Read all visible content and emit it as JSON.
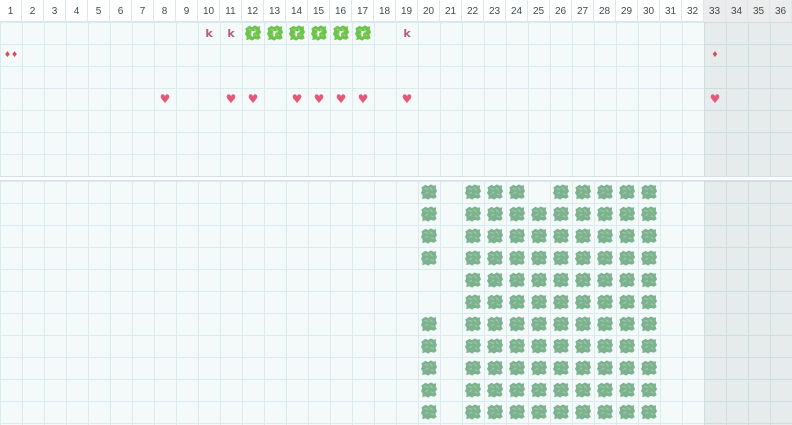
{
  "calendar": {
    "days": [
      "1",
      "2",
      "3",
      "4",
      "5",
      "6",
      "7",
      "8",
      "9",
      "10",
      "11",
      "12",
      "13",
      "14",
      "15",
      "16",
      "17",
      "18",
      "19",
      "20",
      "21",
      "22",
      "23",
      "24",
      "25",
      "26",
      "27",
      "28",
      "29",
      "30",
      "31",
      "32",
      "33",
      "34",
      "35",
      "36"
    ],
    "off_from_day": 33,
    "colors": {
      "grid": "#d9ebee",
      "background": "#f4f9fa",
      "moss": "#7cb38e",
      "sprout": "#6cc44a",
      "heart": "#e4587a",
      "drop": "#dc4a5a",
      "letter": "#b0607a"
    }
  },
  "markers": {
    "k_days": [
      10,
      11,
      19
    ],
    "k_letter": "k",
    "sprout_days": [
      12,
      13,
      14,
      15,
      16,
      17
    ],
    "sprout_letter": "r",
    "drop_days": [
      1,
      33
    ],
    "heart_days": [
      8,
      11,
      12,
      14,
      15,
      16,
      17,
      19,
      33
    ],
    "icons": {
      "k": "k-letter-icon",
      "sprout": "sprout-icon",
      "drop": "drop-icon",
      "heart": "heart-icon",
      "moss": "moss-block-icon"
    }
  },
  "field": {
    "cols": [
      20,
      22,
      23,
      24,
      25,
      26,
      27,
      28,
      29,
      30
    ],
    "rows": 11,
    "gaps": [
      {
        "day": 20,
        "rows": [
          4,
          5
        ]
      },
      {
        "day": 25,
        "rows": [
          0
        ]
      },
      {
        "day": 26,
        "rows": []
      }
    ]
  }
}
